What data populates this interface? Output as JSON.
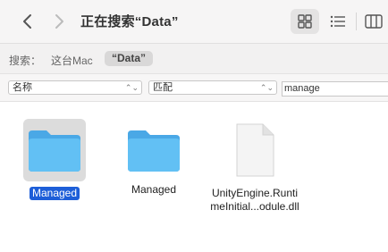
{
  "toolbar": {
    "title": "正在搜索“Data”",
    "back_icon": "chevron-left-icon",
    "forward_icon": "chevron-right-icon",
    "views": [
      "grid-view-icon",
      "list-view-icon",
      "column-view-icon"
    ],
    "active_view": "grid"
  },
  "scope": {
    "label": "搜索：",
    "option_mac": "这台Mac",
    "option_selected": "“Data”"
  },
  "criteria": {
    "attribute": "名称",
    "operator": "匹配",
    "value": "manage"
  },
  "results": [
    {
      "name": "Managed",
      "icon": "folder-icon",
      "selected": true
    },
    {
      "name": "Managed",
      "icon": "folder-icon",
      "selected": false
    },
    {
      "name_line1": "UnityEngine.Runti",
      "name_line2": "meInitial...odule.dll",
      "icon": "document-icon",
      "selected": false
    }
  ],
  "colors": {
    "folder": "#5ab8f0",
    "selection": "#1d5ed8"
  }
}
